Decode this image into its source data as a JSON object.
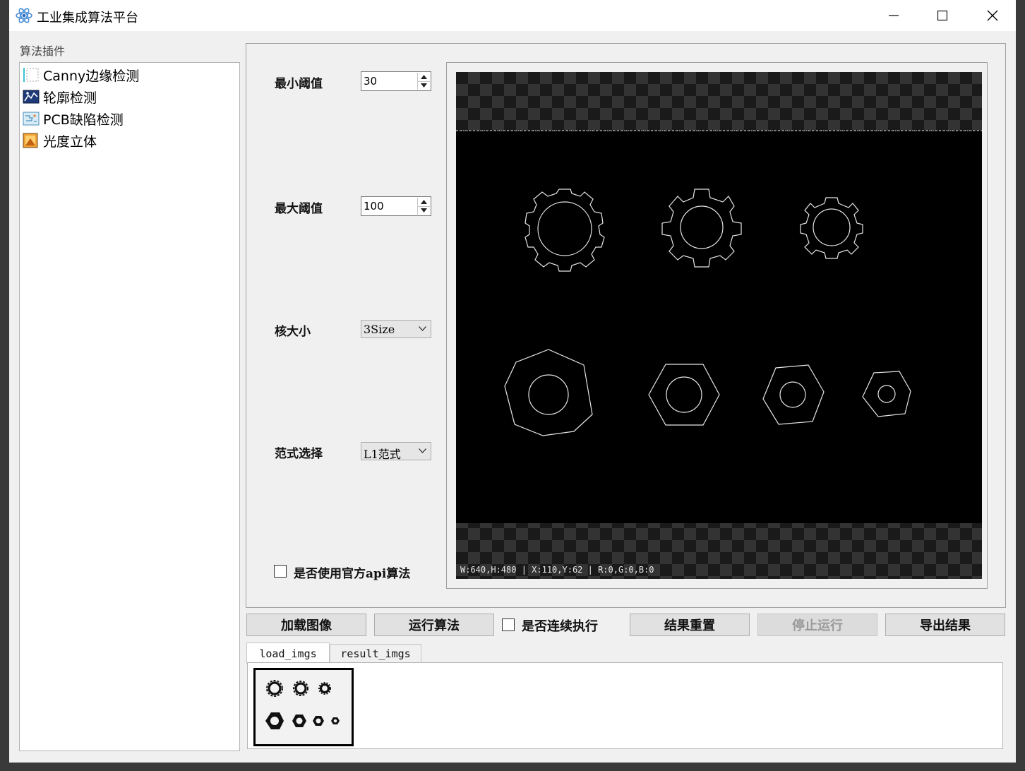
{
  "window": {
    "title": "工业集成算法平台",
    "controls": [
      "minimize-icon",
      "maximize-icon",
      "close-icon"
    ]
  },
  "sidebar": {
    "label": "算法插件",
    "items": [
      {
        "label": "Canny边缘检测",
        "icon": "canny-icon"
      },
      {
        "label": "轮廓检测",
        "icon": "contour-icon"
      },
      {
        "label": "PCB缺陷检测",
        "icon": "pcb-icon"
      },
      {
        "label": "光度立体",
        "icon": "photometric-icon"
      }
    ]
  },
  "params": {
    "min_threshold": {
      "label": "最小阈值",
      "value": "30"
    },
    "max_threshold": {
      "label": "最大阈值",
      "value": "100"
    },
    "kernel_size": {
      "label": "核大小",
      "value": "3Size"
    },
    "norm_select": {
      "label": "范式选择",
      "value": "L1范式"
    },
    "use_official_api": {
      "label": "是否使用官方api算法",
      "checked": false
    }
  },
  "viewer": {
    "status": "W:640,H:480 | X:110,Y:62 | R:0,G:0,B:0"
  },
  "toolbar": {
    "load_label": "加载图像",
    "run_label": "运行算法",
    "continuous_label": "是否连续执行",
    "reset_label": "结果重置",
    "stop_label": "停止运行",
    "export_label": "导出结果"
  },
  "tabs": [
    {
      "label": "load_imgs",
      "active": true
    },
    {
      "label": "result_imgs",
      "active": false
    }
  ],
  "colors": {
    "titlebar": "#ffffff",
    "background": "#f0f0f0",
    "canvas_dark": "#1a1a1a",
    "checker_light": "#333333"
  }
}
